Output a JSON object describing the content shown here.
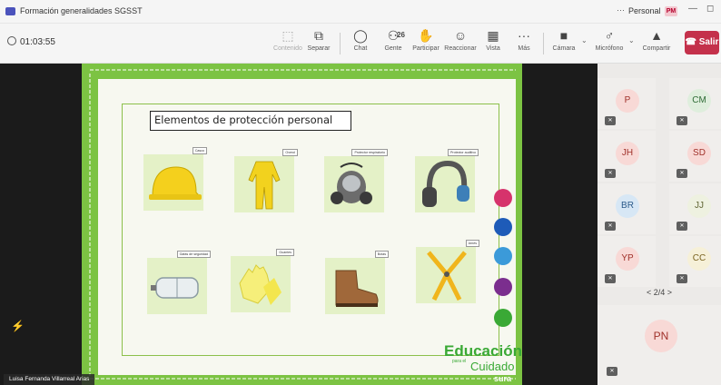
{
  "window": {
    "title": "Formación generalidades SGSST",
    "more_label": "···",
    "profile_label": "Personal",
    "profile_badge": "PM",
    "minimize_label": "—",
    "restore_label": "◻"
  },
  "toolbar": {
    "timer": "01:03:55",
    "buttons": [
      {
        "label": "Contenido",
        "icon": "content-icon",
        "glyph": "⬚"
      },
      {
        "label": "Separar",
        "icon": "pop-out-icon",
        "glyph": "⧉"
      },
      {
        "label": "Chat",
        "icon": "chat-icon",
        "glyph": "◯"
      },
      {
        "label": "Gente",
        "icon": "people-icon",
        "glyph": "⚇",
        "count": "26"
      },
      {
        "label": "Participar",
        "icon": "raise-hand-icon",
        "glyph": "✋"
      },
      {
        "label": "Reaccionar",
        "icon": "react-icon",
        "glyph": "☺"
      },
      {
        "label": "Vista",
        "icon": "view-icon",
        "glyph": "▦"
      },
      {
        "label": "Más",
        "icon": "more-icon",
        "glyph": "···"
      },
      {
        "label": "Cámara",
        "icon": "camera-off-icon",
        "glyph": "■"
      },
      {
        "label": "Micrófono",
        "icon": "mic-off-icon",
        "glyph": "♂"
      },
      {
        "label": "Compartir",
        "icon": "share-icon",
        "glyph": "▲"
      }
    ],
    "leave_label": "Salir"
  },
  "slide": {
    "title": "Elementos de protección personal",
    "items": [
      {
        "tag": "Casco",
        "icon": "helmet-icon"
      },
      {
        "tag": "Overol",
        "icon": "overall-icon"
      },
      {
        "tag": "Protector respiratorio",
        "icon": "respirator-icon"
      },
      {
        "tag": "Protector auditivo",
        "icon": "earmuffs-icon"
      },
      {
        "tag": "Gafas de seguridad",
        "icon": "goggles-icon"
      },
      {
        "tag": "Guantes",
        "icon": "gloves-icon"
      },
      {
        "tag": "Botas",
        "icon": "boots-icon"
      },
      {
        "tag": "Arnés",
        "icon": "harness-icon"
      }
    ],
    "side_icons": [
      {
        "icon": "heart-icon",
        "color": "#d6336c"
      },
      {
        "icon": "database-icon",
        "color": "#1e5bb8"
      },
      {
        "icon": "globe-icon",
        "color": "#3b9ad9"
      },
      {
        "icon": "diamond-icon",
        "color": "#7b2e8e"
      },
      {
        "icon": "leaf-icon",
        "color": "#3aa935"
      }
    ],
    "brand": {
      "main": "Educación",
      "para": "para el",
      "sub": "Cuidado",
      "company": "sura"
    }
  },
  "presenter": {
    "name": "Luisa Fernanda Villarreal Arias"
  },
  "participants": [
    {
      "initials": "P",
      "bg": "#f8d9d6",
      "fg": "#a0312a"
    },
    {
      "initials": "CM",
      "bg": "#dfeedd",
      "fg": "#2f6b36"
    },
    {
      "initials": "JH",
      "bg": "#f8d9d6",
      "fg": "#a0312a"
    },
    {
      "initials": "SD",
      "bg": "#f8d9d6",
      "fg": "#a0312a"
    },
    {
      "initials": "BR",
      "bg": "#d7e7f5",
      "fg": "#2b5a8a"
    },
    {
      "initials": "JJ",
      "bg": "#eef1e0",
      "fg": "#5d6230"
    },
    {
      "initials": "YP",
      "bg": "#f8d9d6",
      "fg": "#a0312a"
    },
    {
      "initials": "CC",
      "bg": "#f6f0d8",
      "fg": "#7a6320"
    }
  ],
  "pager": {
    "label": "<  2/4  >"
  },
  "pinned": {
    "initials": "PN",
    "bg": "#f8d9d6",
    "fg": "#a0312a"
  }
}
